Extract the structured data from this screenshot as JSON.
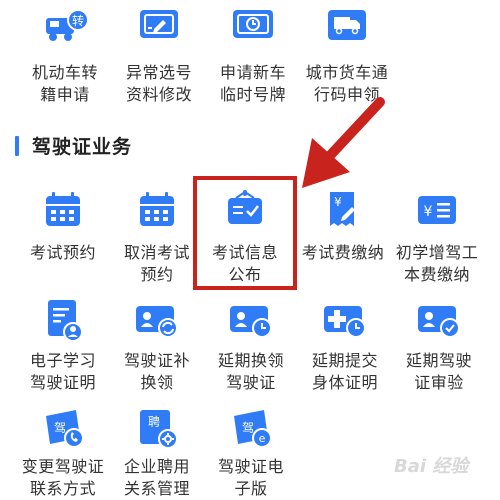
{
  "colors": {
    "accent": "#2f7cf6",
    "highlight": "#c8241d",
    "text": "#333333"
  },
  "top_row": [
    {
      "label": "机动车转\n籍申请",
      "icon": "car-transfer-icon"
    },
    {
      "label": "异常选号\n资料修改",
      "icon": "edit-card-icon"
    },
    {
      "label": "申请新车\n临时号牌",
      "icon": "temporary-plate-icon"
    },
    {
      "label": "城市货车通\n行码申领",
      "icon": "truck-icon"
    }
  ],
  "section": {
    "title": "驾驶证业务"
  },
  "grid": [
    {
      "label": "考试预约",
      "icon": "calendar-icon"
    },
    {
      "label": "取消考试\n预约",
      "icon": "calendar-icon"
    },
    {
      "label": "考试信息\n公布",
      "icon": "notice-board-icon"
    },
    {
      "label": "考试费缴纳",
      "icon": "receipt-yen-icon"
    },
    {
      "label": "初学增驾工\n本费缴纳",
      "icon": "yen-list-icon"
    },
    {
      "label": "电子学习\n驾驶证明",
      "icon": "document-user-icon"
    },
    {
      "label": "驾驶证补\n换领",
      "icon": "license-refresh-icon"
    },
    {
      "label": "延期换领\n驾驶证",
      "icon": "license-clock-icon"
    },
    {
      "label": "延期提交\n身体证明",
      "icon": "health-clock-icon"
    },
    {
      "label": "延期驾驶\n证审验",
      "icon": "license-check-icon"
    },
    {
      "label": "变更驾驶证\n联系方式",
      "icon": "license-phone-icon"
    },
    {
      "label": "企业聘用\n关系管理",
      "icon": "employ-gear-icon"
    },
    {
      "label": "驾驶证电\n子版",
      "icon": "license-e-icon"
    }
  ],
  "icon_text": {
    "transfer": "转",
    "yen": "¥",
    "jia": "驾",
    "pin": "聘",
    "e": "e"
  },
  "watermark": "Bai 经验"
}
